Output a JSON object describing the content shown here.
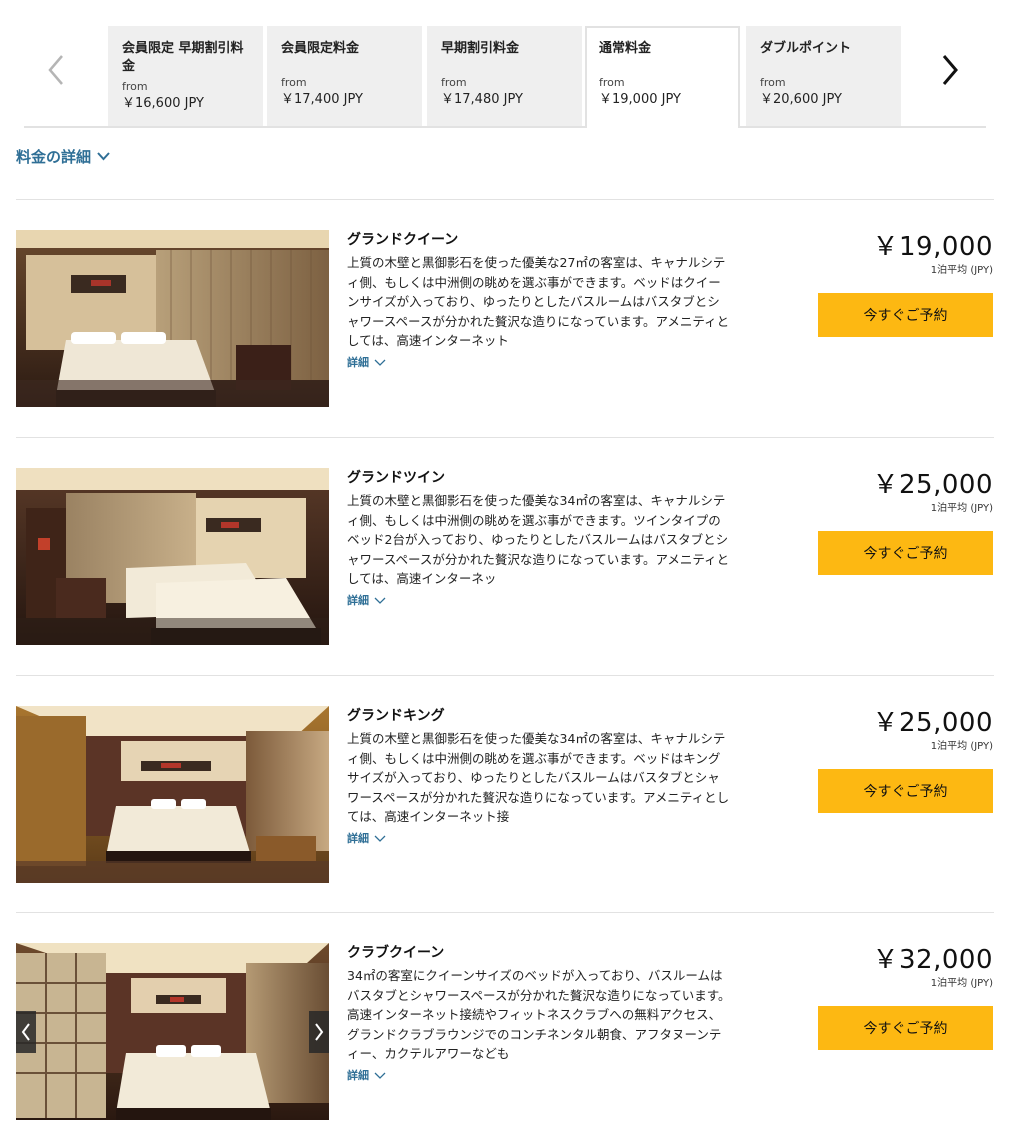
{
  "rate_tabs": [
    {
      "title": "会員限定 早期割引料金",
      "from": "from",
      "price": "￥16,600 JPY",
      "active": false
    },
    {
      "title": "会員限定料金",
      "from": "from",
      "price": "￥17,400 JPY",
      "active": false
    },
    {
      "title": "早期割引料金",
      "from": "from",
      "price": "￥17,480 JPY",
      "active": false
    },
    {
      "title": "通常料金",
      "from": "from",
      "price": "￥19,000 JPY",
      "active": true
    },
    {
      "title": "ダブルポイント",
      "from": "from",
      "price": "￥20,600 JPY",
      "active": false
    }
  ],
  "nav": {
    "prev_icon": "chevron-left-icon",
    "next_icon": "chevron-right-icon"
  },
  "rate_details": {
    "label": "料金の詳細",
    "icon": "chevron-down-icon"
  },
  "rooms": [
    {
      "name": "グランドクイーン",
      "description": "上質の木壁と黒御影石を使った優美な27㎡の客室は、キャナルシティ側、もしくは中洲側の眺めを選ぶ事ができます。ベッドはクイーンサイズが入っており、ゆったりとしたバスルームはバスタブとシャワースペースが分かれた贅沢な造りになっています。アメニティとしては、高速インターネット",
      "more": "詳細",
      "price": "￥19,000",
      "price_note": "1泊平均 (JPY)",
      "book": "今すぐご予約"
    },
    {
      "name": "グランドツイン",
      "description": "上質の木壁と黒御影石を使った優美な34㎡の客室は、キャナルシティ側、もしくは中洲側の眺めを選ぶ事ができます。ツインタイプのベッド2台が入っており、ゆったりとしたバスルームはバスタブとシャワースペースが分かれた贅沢な造りになっています。アメニティとしては、高速インターネッ",
      "more": "詳細",
      "price": "￥25,000",
      "price_note": "1泊平均 (JPY)",
      "book": "今すぐご予約"
    },
    {
      "name": "グランドキング",
      "description": "上質の木壁と黒御影石を使った優美な34㎡の客室は、キャナルシティ側、もしくは中洲側の眺めを選ぶ事ができます。ベッドはキングサイズが入っており、ゆったりとしたバスルームはバスタブとシャワースペースが分かれた贅沢な造りになっています。アメニティとしては、高速インターネット接",
      "more": "詳細",
      "price": "￥25,000",
      "price_note": "1泊平均 (JPY)",
      "book": "今すぐご予約"
    },
    {
      "name": "クラブクイーン",
      "description": "34㎡の客室にクイーンサイズのベッドが入っており、バスルームはバスタブとシャワースペースが分かれた贅沢な造りになっています。高速インターネット接続やフィットネスクラブへの無料アクセス、グランドクラブラウンジでのコンチネンタル朝食、アフタヌーンティー、カクテルアワーなども",
      "more": "詳細",
      "price": "￥32,000",
      "price_note": "1泊平均 (JPY)",
      "book": "今すぐご予約"
    }
  ],
  "colors": {
    "accent": "#fdb812",
    "link": "#2f6f96",
    "tab_bg": "#efefef"
  }
}
